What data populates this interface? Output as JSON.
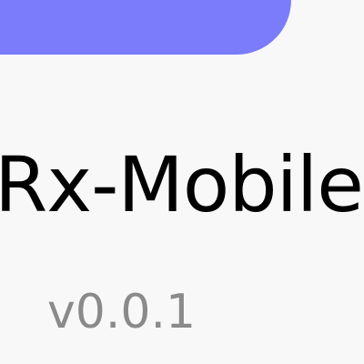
{
  "colors": {
    "accent": "#7b7cfb",
    "background": "#f8f8f8",
    "title": "#000000",
    "version": "#8a8a8a"
  },
  "app": {
    "title": "Rx-Mobile",
    "version": "v0.0.1"
  }
}
